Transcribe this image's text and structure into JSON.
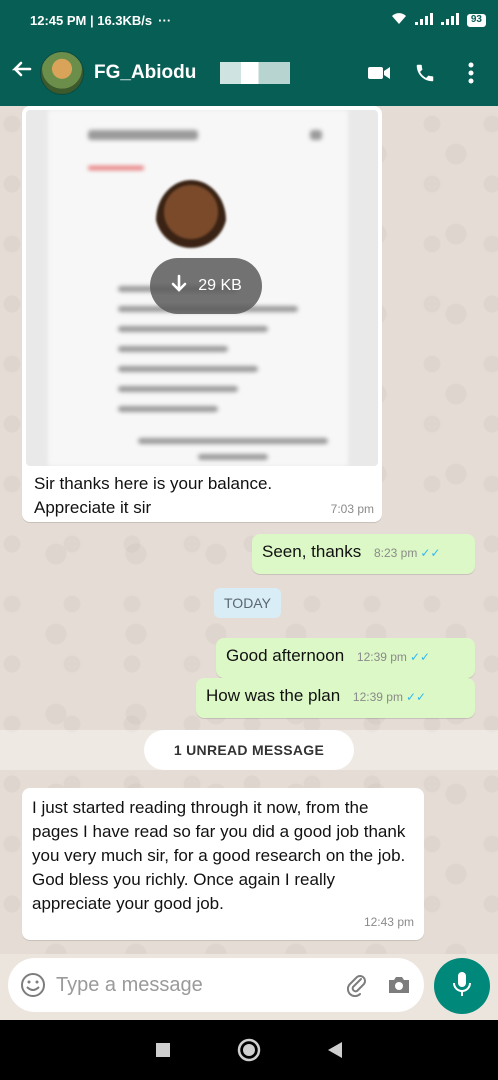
{
  "status_bar": {
    "time_speed": "12:45 PM | 16.3KB/s",
    "dots": "···",
    "battery": "93"
  },
  "header": {
    "contact_name": "FG_Abiodu"
  },
  "messages": {
    "image_msg": {
      "download_size": "29 KB",
      "caption_line1": "Sir thanks here is your balance.",
      "caption_line2": "Appreciate it sir",
      "time": "7:03 pm"
    },
    "seen": {
      "text": "Seen, thanks",
      "time": "8:23 pm"
    },
    "date_chip": "TODAY",
    "good_afternoon": {
      "text": "Good afternoon",
      "time": "12:39 pm"
    },
    "plan": {
      "text": "How was the plan",
      "time": "12:39 pm"
    },
    "unread_label": "1 UNREAD MESSAGE",
    "long": {
      "text": "I just started reading through it now, from the pages I have read so far you did a good job thank you very much sir, for a good research on the job. God bless you richly. Once again I really appreciate your good job.",
      "time": "12:43 pm"
    }
  },
  "input": {
    "placeholder": "Type a message"
  },
  "colors": {
    "header": "#075e54",
    "outgoing": "#dcf8c6",
    "incoming": "#ffffff",
    "read_tick": "#34b7f1",
    "fab": "#00897b"
  },
  "icons": [
    "back-arrow-icon",
    "video-call-icon",
    "phone-icon",
    "more-vert-icon",
    "download-icon",
    "emoji-icon",
    "attach-icon",
    "camera-icon",
    "mic-icon",
    "nav-square-icon",
    "nav-circle-icon",
    "nav-back-icon",
    "wifi-icon",
    "signal-icon"
  ]
}
